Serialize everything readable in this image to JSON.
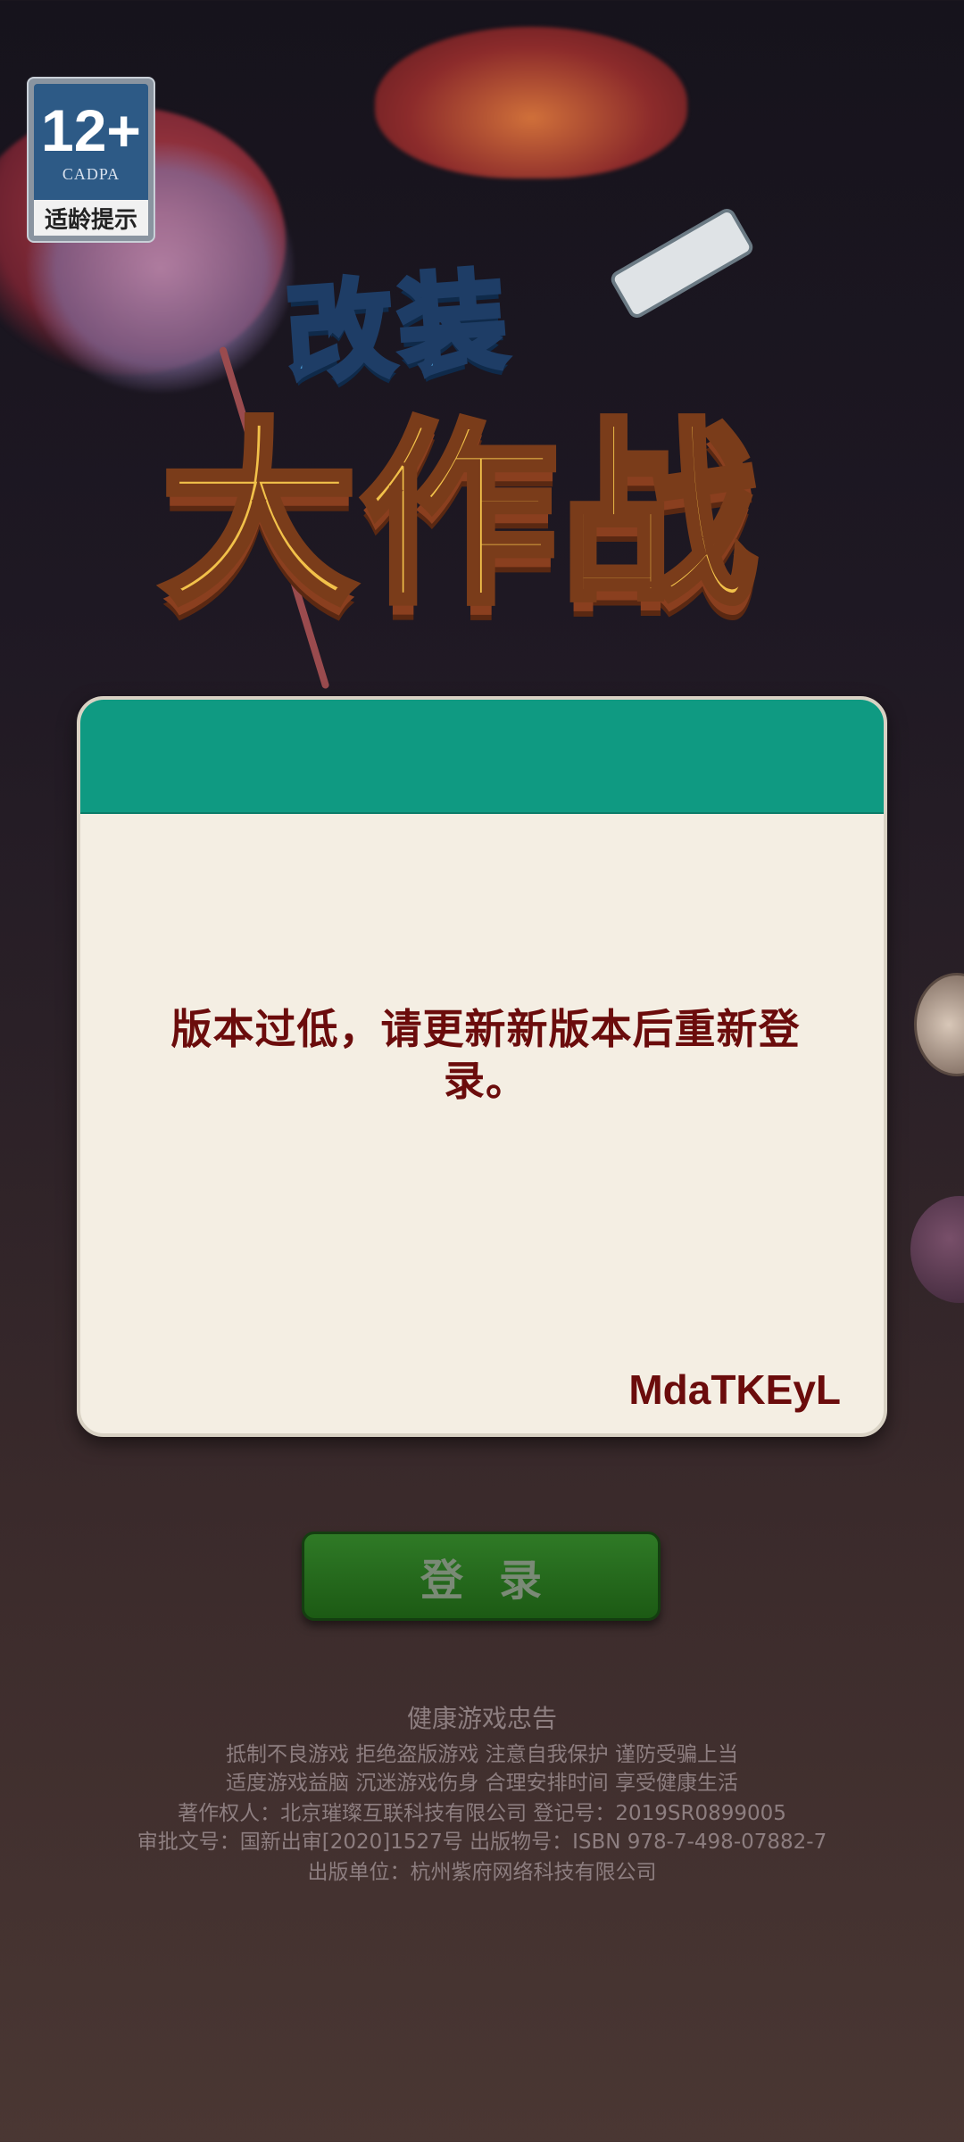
{
  "age_badge": {
    "rating": "12+",
    "org": "CADPA",
    "label": "适龄提示"
  },
  "logo": {
    "line1": "改装",
    "line2": "大作战"
  },
  "dialog": {
    "message": "版本过低，请更新新版本后重新登录。",
    "code": "MdaTKEyL"
  },
  "login_button": {
    "label": "登录"
  },
  "health_notice": {
    "title": "健康游戏忠告",
    "line1": "抵制不良游戏 拒绝盗版游戏 注意自我保护 谨防受骗上当",
    "line2": "适度游戏益脑 沉迷游戏伤身 合理安排时间 享受健康生活",
    "line3": "著作权人：北京璀璨互联科技有限公司   登记号：2019SR0899005",
    "line4": "审批文号：国新出审[2020]1527号   出版物号：ISBN 978-7-498-07882-7",
    "line5": "出版单位：杭州紫府网络科技有限公司"
  }
}
